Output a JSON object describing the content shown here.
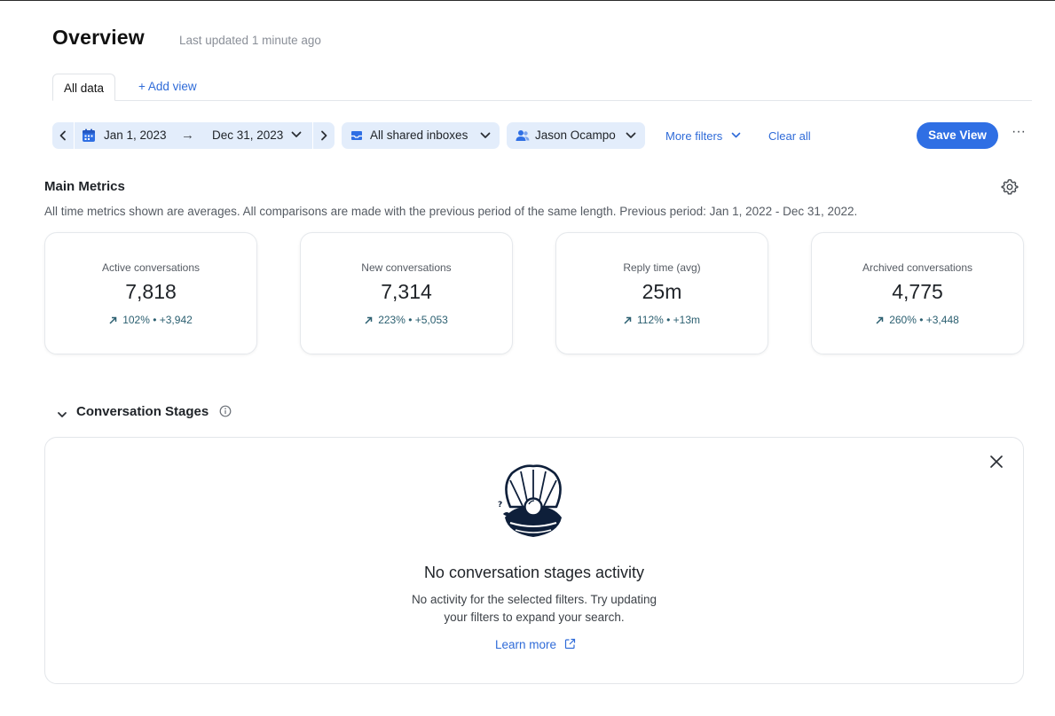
{
  "header": {
    "title": "Overview",
    "last_updated": "Last updated 1 minute ago"
  },
  "tabs": {
    "active": "All data",
    "add_view": "+ Add view"
  },
  "filters": {
    "date_start": "Jan 1, 2023",
    "date_arrow": "→",
    "date_end": "Dec 31, 2023",
    "inbox": "All shared inboxes",
    "user": "Jason Ocampo",
    "more_filters": "More filters",
    "clear_all": "Clear all",
    "save_view": "Save View",
    "more": "···"
  },
  "main_metrics": {
    "title": "Main Metrics",
    "description": "All time metrics shown are averages. All comparisons are made with the previous period of the same length. Previous period: Jan 1, 2022 - Dec 31, 2022.",
    "cards": [
      {
        "label": "Active conversations",
        "value": "7,818",
        "delta": "102%  •  +3,942"
      },
      {
        "label": "New conversations",
        "value": "7,314",
        "delta": "223%  •  +5,053"
      },
      {
        "label": "Reply time (avg)",
        "value": "25m",
        "delta": "112%  •  +13m"
      },
      {
        "label": "Archived conversations",
        "value": "4,775",
        "delta": "260%  •  +3,448"
      }
    ]
  },
  "stages": {
    "title": "Conversation Stages",
    "empty_title": "No conversation stages activity",
    "empty_line1": "No activity for the selected filters. Try updating",
    "empty_line2": "your filters to expand your search.",
    "learn_more": "Learn more"
  },
  "colors": {
    "accent": "#2f6fe4",
    "pill_bg": "#e3edfb",
    "delta": "#2b5f70"
  },
  "icons": {
    "calendar": "calendar-icon",
    "inbox": "inbox-icon",
    "user": "user-icon",
    "settings": "gear-icon",
    "info": "info-icon",
    "close": "close-icon",
    "external": "external-link-icon"
  }
}
